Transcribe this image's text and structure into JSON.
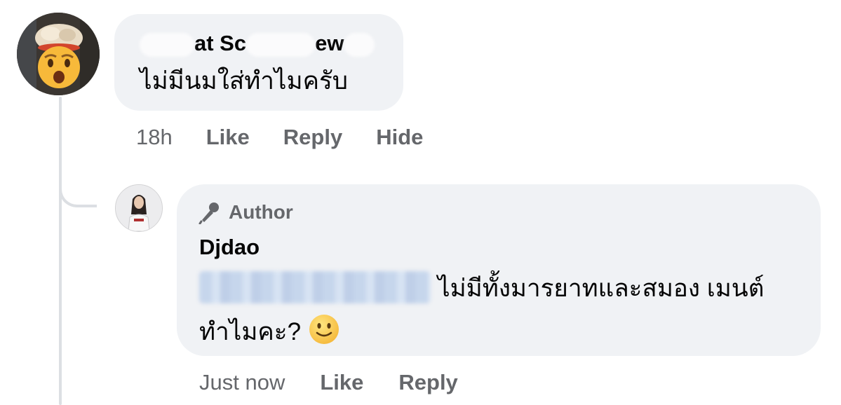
{
  "main_comment": {
    "author_partial_a": "at Sc",
    "author_partial_b": "ew",
    "text": "ไม่มีนมใส่ทำไมครับ",
    "time": "18h",
    "actions": {
      "like": "Like",
      "reply": "Reply",
      "hide": "Hide"
    },
    "avatar_icon": "exploding-head-emoji-avatar"
  },
  "reply_comment": {
    "badge": "Author",
    "badge_icon": "microphone-icon",
    "author": "Djdao",
    "text": "ไม่มีทั้งมารยาทและสมอง เมนต์ทำไมคะ?",
    "emoji": "slightly-smiling-face-emoji",
    "time": "Just now",
    "actions": {
      "like": "Like",
      "reply": "Reply"
    }
  },
  "colors": {
    "bubble_bg": "#f0f2f5",
    "meta_text": "#65676b",
    "primary_text": "#050505",
    "thread_line": "#dcdfe3",
    "mention_blur": "#c6d6ec"
  }
}
